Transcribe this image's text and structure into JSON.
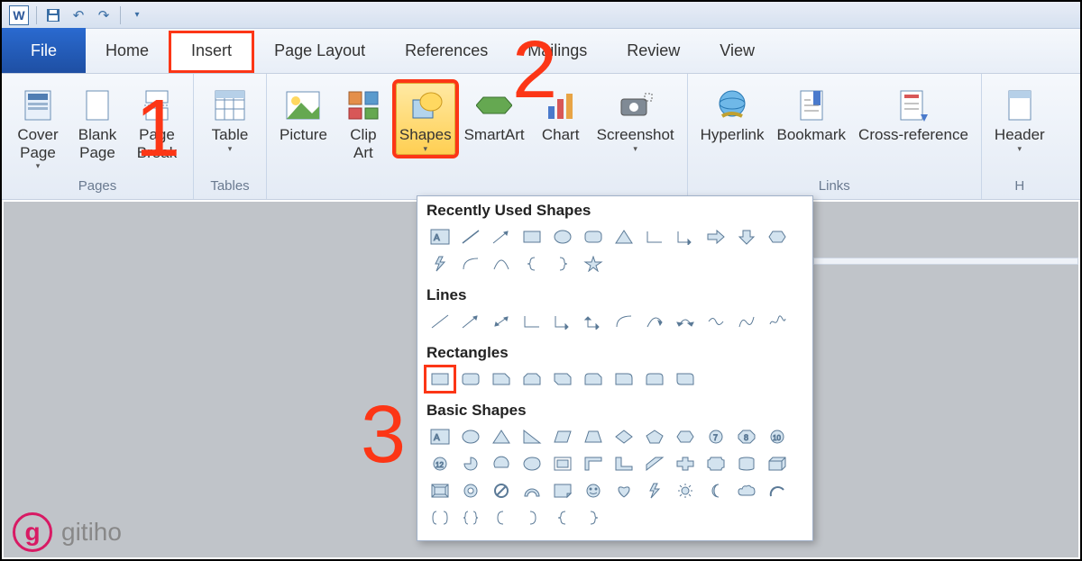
{
  "qat": {
    "app": "W"
  },
  "tabs": {
    "file": "File",
    "items": [
      "Home",
      "Insert",
      "Page Layout",
      "References",
      "Mailings",
      "Review",
      "View"
    ],
    "activeIndex": 1
  },
  "ribbon": {
    "pages": {
      "label": "Pages",
      "cover": "Cover\nPage",
      "blank": "Blank\nPage",
      "pagebreak": "Page\nBreak"
    },
    "tables": {
      "label": "Tables",
      "table": "Table"
    },
    "illustrations": {
      "picture": "Picture",
      "clipart": "Clip\nArt",
      "shapes": "Shapes",
      "smartart": "SmartArt",
      "chart": "Chart",
      "screenshot": "Screenshot"
    },
    "links": {
      "label": "Links",
      "hyperlink": "Hyperlink",
      "bookmark": "Bookmark",
      "crossref": "Cross-reference"
    },
    "header": "Header",
    "headerGroup": "H"
  },
  "shapes_panel": {
    "sections": {
      "recent": "Recently Used Shapes",
      "lines": "Lines",
      "rects": "Rectangles",
      "basic": "Basic Shapes"
    }
  },
  "annotations": {
    "n1": "1",
    "n2": "2",
    "n3": "3"
  },
  "watermark": "gitiho"
}
